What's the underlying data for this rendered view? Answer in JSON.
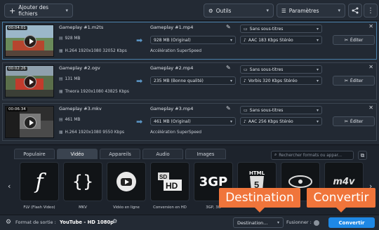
{
  "toolbar": {
    "add_files_label": "Ajouter des fichiers",
    "tools_label": "Outils",
    "settings_label": "Paramètres"
  },
  "files": [
    {
      "duration": "00:04:01",
      "src_name": "Gameplay #1.m2ts",
      "src_size": "928 MB",
      "src_codec": "H.264 1920x1080 32052 Kbps",
      "out_name": "Gameplay #1.mp4",
      "out_size": "928 MB (Original)",
      "accel": "Accélération SuperSpeed",
      "subtitles": "Sans sous-titres",
      "audio": "AAC 183 Kbps Stéréo",
      "edit_label": "Éditer"
    },
    {
      "duration": "00:02:26",
      "src_name": "Gameplay #2.ogv",
      "src_size": "131 MB",
      "src_codec": "Theora 1920x1080 43825 Kbps",
      "out_name": "Gameplay #2.mp4",
      "out_size": "235 MB (Bonne qualité)",
      "accel": "",
      "subtitles": "Sans sous-titres",
      "audio": "Vorbis 320 Kbps Stéréo",
      "edit_label": "Éditer"
    },
    {
      "duration": "00:06:34",
      "src_name": "Gameplay #3.mkv",
      "src_size": "461 MB",
      "src_codec": "H.264 1920x1080 9550 Kbps",
      "out_name": "Gameplay #3.mp4",
      "out_size": "461 MB (Original)",
      "accel": "Accélération SuperSpeed",
      "subtitles": "Sans sous-titres",
      "audio": "AAC 256 Kbps Stéréo",
      "edit_label": "Éditer"
    }
  ],
  "format_tabs": [
    "Populaire",
    "Vidéo",
    "Appareils",
    "Audio",
    "Images"
  ],
  "active_tab": "Vidéo",
  "search_placeholder": "Rechercher formats ou appar...",
  "formats": [
    {
      "label": "FLV (Flash Video)",
      "icon": "flash-icon"
    },
    {
      "label": "MKV",
      "icon": "mkv-icon"
    },
    {
      "label": "Vidéo en ligne",
      "icon": "youtube-icon"
    },
    {
      "label": "Conversion en HD",
      "icon": "sd-hd-icon"
    },
    {
      "label": "3GP, 3G",
      "icon": "3gp-icon"
    },
    {
      "label": "",
      "icon": "html5-icon"
    },
    {
      "label": "",
      "icon": "bluray-icon"
    },
    {
      "label": "",
      "icon": "m4v-icon"
    }
  ],
  "format_badges": {
    "html": "HTML",
    "three_g": "3GP",
    "m4v": "m4v"
  },
  "bottom": {
    "output_format_label": "Format de sortie :",
    "output_format_value": "YouTube - HD 1080p",
    "destination_label": "Destination...",
    "merge_label": "Fusionner :",
    "convert_label": "Convertir"
  },
  "callouts": {
    "destination": "Destination",
    "convert": "Convertir"
  },
  "colors": {
    "accent": "#1e88e5",
    "callout": "#f0753b",
    "row_border_active": "#4a7fa8"
  }
}
